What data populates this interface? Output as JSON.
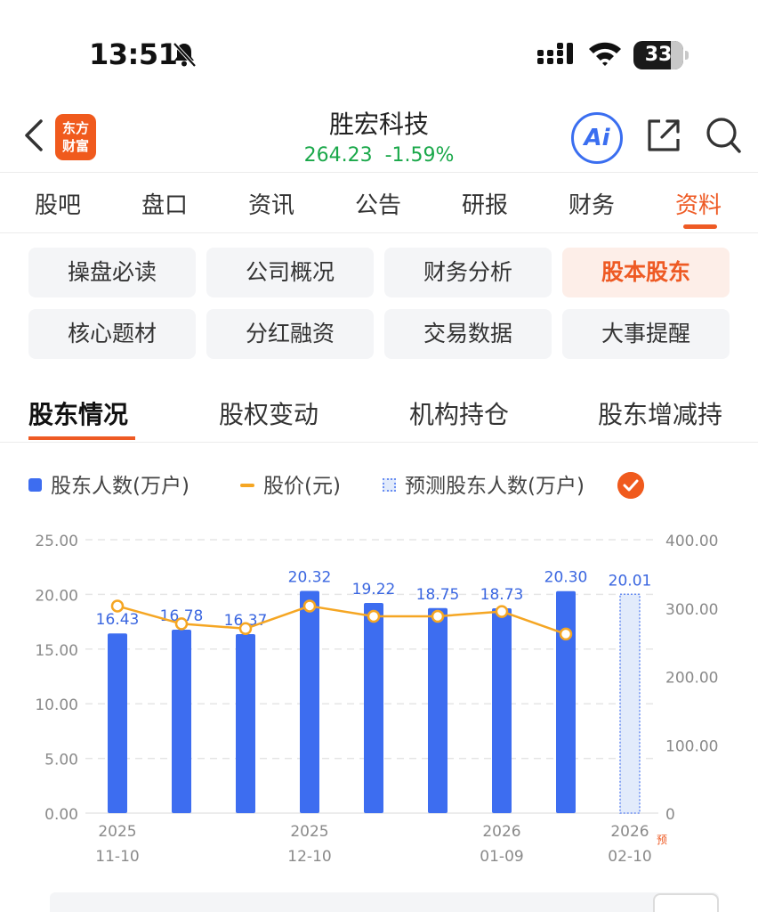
{
  "status_bar": {
    "time": "13:51",
    "battery": "33"
  },
  "header": {
    "logo_line1": "东方",
    "logo_line2": "财富",
    "stock_name": "胜宏科技",
    "price": "264.23",
    "change_pct": "-1.59%",
    "ai_label": "Ai"
  },
  "main_tabs": [
    {
      "label": "股吧"
    },
    {
      "label": "盘口"
    },
    {
      "label": "资讯"
    },
    {
      "label": "公告"
    },
    {
      "label": "研报"
    },
    {
      "label": "财务"
    },
    {
      "label": "资料"
    }
  ],
  "main_tab_active": "资料",
  "categories": [
    {
      "label": "操盘必读"
    },
    {
      "label": "公司概况"
    },
    {
      "label": "财务分析"
    },
    {
      "label": "股本股东"
    },
    {
      "label": "核心题材"
    },
    {
      "label": "分红融资"
    },
    {
      "label": "交易数据"
    },
    {
      "label": "大事提醒"
    }
  ],
  "category_active": "股本股东",
  "sub_tabs": [
    {
      "label": "股东情况"
    },
    {
      "label": "股权变动"
    },
    {
      "label": "机构持仓"
    },
    {
      "label": "股东增减持"
    }
  ],
  "sub_tab_active": "股东情况",
  "legend": {
    "holders": "股东人数(万户)",
    "price": "股价(元)",
    "forecast": "预测股东人数(万户)"
  },
  "colors": {
    "accent": "#ee5a24",
    "bar": "#3d6df0",
    "line": "#f5a623",
    "up_down": "#1aa84a"
  },
  "chart_data": {
    "type": "bar",
    "y_left_ticks": [
      "25.00",
      "20.00",
      "15.00",
      "10.00",
      "5.00",
      "0.00"
    ],
    "y_left_range": [
      0,
      25
    ],
    "y_right_ticks": [
      "400.00",
      "300.00",
      "200.00",
      "100.00",
      "0"
    ],
    "y_right_range": [
      0,
      400
    ],
    "x_tick_labels": [
      {
        "year": "2025",
        "date": "11-10",
        "bar_index": 0
      },
      {
        "year": "2025",
        "date": "12-10",
        "bar_index": 3
      },
      {
        "year": "2026",
        "date": "01-09",
        "bar_index": 6
      },
      {
        "year": "2026",
        "date": "02-10",
        "bar_index": 8
      }
    ],
    "forecast_marker": "预",
    "series": [
      {
        "name": "股东人数(万户)",
        "values": [
          16.43,
          16.78,
          16.37,
          20.32,
          19.22,
          18.75,
          18.73,
          20.3
        ]
      },
      {
        "name": "股价(元)",
        "values": [
          303,
          277,
          270,
          303,
          288,
          288,
          295,
          262
        ]
      },
      {
        "name": "预测股东人数(万户)",
        "values": [
          null,
          null,
          null,
          null,
          null,
          null,
          null,
          null,
          20.01
        ]
      }
    ],
    "bar_labels": [
      "16.43",
      "16.78",
      "16.37",
      "20.32",
      "19.22",
      "18.75",
      "18.73",
      "20.30",
      "20.01"
    ],
    "grid": true
  }
}
